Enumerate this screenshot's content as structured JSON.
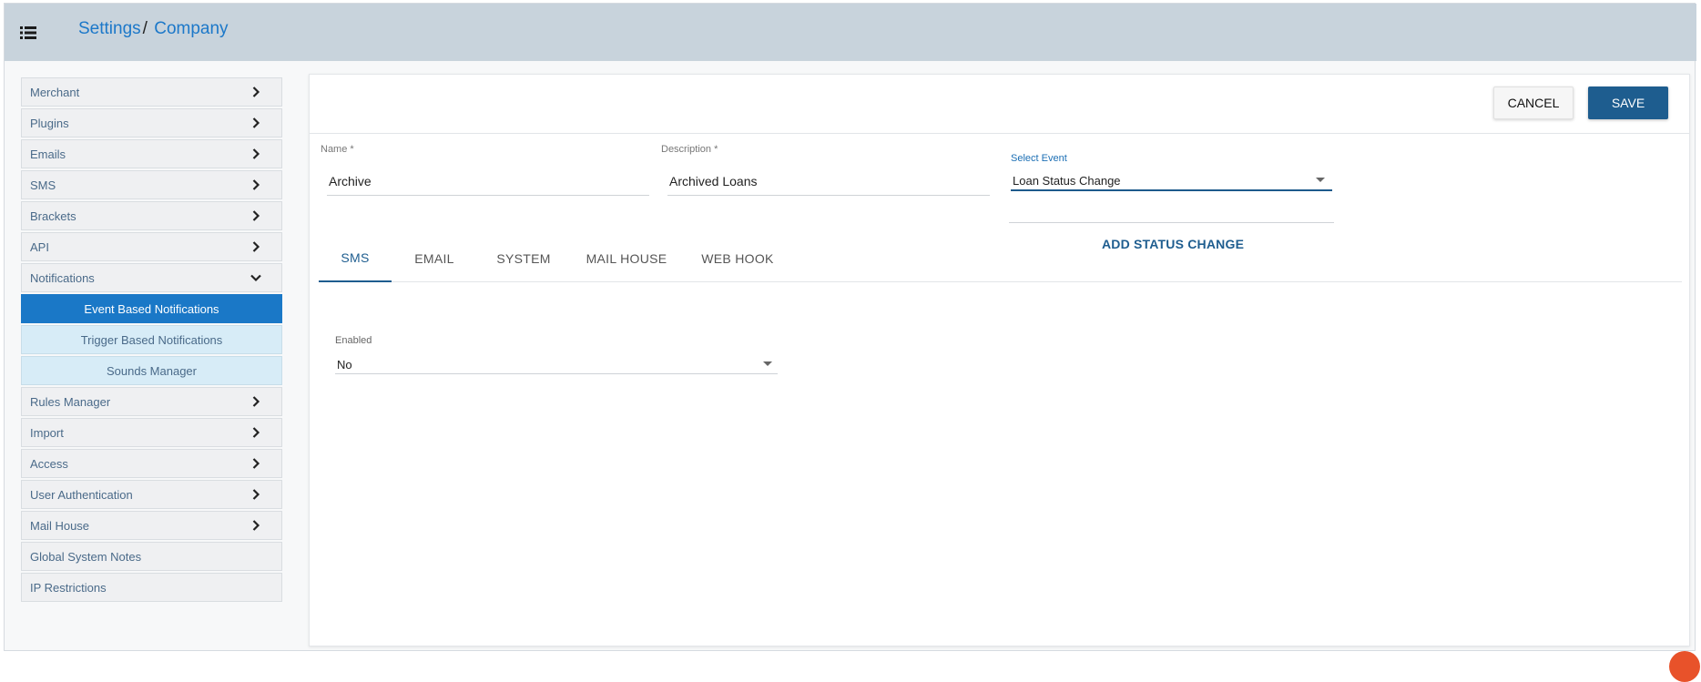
{
  "header": {
    "menu_icon": "list-menu-icon",
    "breadcrumb_root": "Settings",
    "breadcrumb_sep": "/",
    "breadcrumb_current": "Company"
  },
  "sidebar": {
    "items": [
      {
        "label": "Merchant",
        "icon": "chevron-right-icon"
      },
      {
        "label": "Plugins",
        "icon": "chevron-right-icon"
      },
      {
        "label": "Emails",
        "icon": "chevron-right-icon"
      },
      {
        "label": "SMS",
        "icon": "chevron-right-icon"
      },
      {
        "label": "Brackets",
        "icon": "chevron-right-icon"
      },
      {
        "label": "API",
        "icon": "chevron-right-icon"
      },
      {
        "label": "Notifications",
        "icon": "chevron-down-icon"
      }
    ],
    "subitems": [
      {
        "label": "Event Based Notifications",
        "active": true
      },
      {
        "label": "Trigger Based Notifications",
        "active": false
      },
      {
        "label": "Sounds Manager",
        "active": false
      }
    ],
    "items_after": [
      {
        "label": "Rules Manager",
        "icon": "chevron-right-icon"
      },
      {
        "label": "Import",
        "icon": "chevron-right-icon"
      },
      {
        "label": "Access",
        "icon": "chevron-right-icon"
      },
      {
        "label": "User Authentication",
        "icon": "chevron-right-icon"
      },
      {
        "label": "Mail House",
        "icon": "chevron-right-icon"
      },
      {
        "label": "Global System Notes",
        "icon": ""
      },
      {
        "label": "IP Restrictions",
        "icon": ""
      }
    ]
  },
  "toolbar": {
    "cancel_label": "CANCEL",
    "save_label": "SAVE"
  },
  "form": {
    "name_label": "Name *",
    "name_value": "Archive",
    "description_label": "Description *",
    "description_value": "Archived Loans",
    "select_event_label": "Select Event",
    "select_event_value": "Loan Status Change",
    "add_status_label": "ADD STATUS CHANGE"
  },
  "tabs": [
    {
      "label": "SMS",
      "active": true
    },
    {
      "label": "EMAIL",
      "active": false
    },
    {
      "label": "SYSTEM",
      "active": false
    },
    {
      "label": "MAIL HOUSE",
      "active": false
    },
    {
      "label": "WEB HOOK",
      "active": false
    }
  ],
  "sms_tab": {
    "enabled_label": "Enabled",
    "enabled_value": "No"
  },
  "colors": {
    "topbar": "#c8d3dc",
    "accent": "#1e5d8f",
    "active_item": "#1a78c7",
    "breadcrumb": "#1c78c9"
  }
}
